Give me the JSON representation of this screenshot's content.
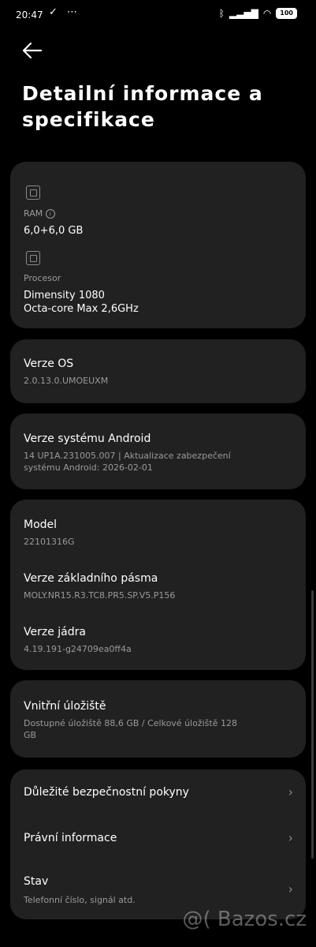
{
  "status": {
    "time": "20:47",
    "left_icons": "✓ ⋯",
    "battery": "100"
  },
  "page": {
    "title": "Detailní informace a specifikace"
  },
  "hw": {
    "ram_label": "RAM",
    "ram_value": "6,0+6,0 GB",
    "cpu_label": "Procesor",
    "cpu_line1": "Dimensity 1080",
    "cpu_line2": "Octa-core Max 2,6GHz"
  },
  "os": {
    "label": "Verze OS",
    "value": "2.0.13.0.UMOEUXM"
  },
  "android": {
    "label": "Verze systému Android",
    "line1": "14 UP1A.231005.007 | Aktualizace zabezpečení",
    "line2": "systému Android: 2026-02-01"
  },
  "device": {
    "model_label": "Model",
    "model_value": "22101316G",
    "baseband_label": "Verze základního pásma",
    "baseband_value": "MOLY.NR15.R3.TC8.PR5.SP.V5.P156",
    "kernel_label": "Verze jádra",
    "kernel_value": "4.19.191-g24709ea0ff4a"
  },
  "storage": {
    "label": "Vnitřní úložiště",
    "line1": "Dostupné úložiště  88,6 GB / Celkové úložiště  128",
    "line2": "GB"
  },
  "links": {
    "safety": "Důležité bezpečnostní pokyny",
    "legal": "Právní informace",
    "state": "Stav",
    "state_sub": "Telefonní číslo, signál atd."
  },
  "watermark": "@( Bazos.cz"
}
